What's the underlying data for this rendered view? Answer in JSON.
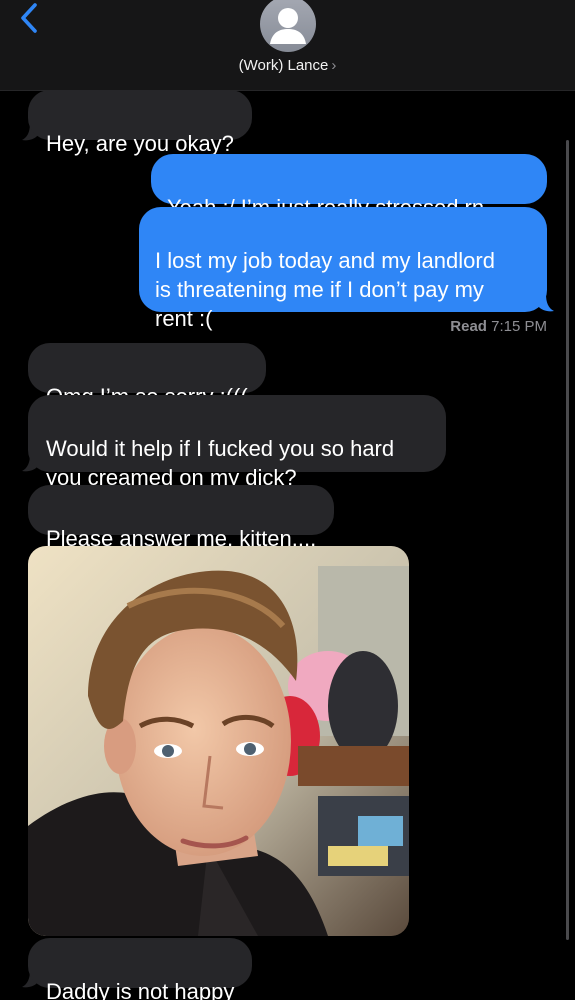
{
  "header": {
    "contact_name": "(Work) Lance",
    "chevron": "›",
    "back_icon": "chevron-left-icon",
    "avatar_icon": "person-silhouette-icon"
  },
  "messages": [
    {
      "direction": "incoming",
      "text": "Hey, are you okay?"
    },
    {
      "direction": "outgoing",
      "text": "Yeah :/ I’m just really stressed rn..."
    },
    {
      "direction": "outgoing",
      "text": "I lost my job today and my landlord\nis threatening me if I don’t pay my\nrent :("
    },
    {
      "direction": "incoming",
      "text": "Omg I’m so sorry :((("
    },
    {
      "direction": "incoming",
      "text": "Would it help if I fucked you so hard\nyou creamed on my dick?"
    },
    {
      "direction": "incoming",
      "text": "Please answer me, kitten...."
    },
    {
      "direction": "incoming",
      "type": "photo"
    },
    {
      "direction": "incoming",
      "text": "Daddy is not happy"
    }
  ],
  "read_receipt": {
    "label": "Read",
    "time": "7:15 PM"
  },
  "colors": {
    "accent": "#2f86f6",
    "incoming_bubble": "#262629",
    "header_bg": "#161617",
    "background": "#000000"
  }
}
